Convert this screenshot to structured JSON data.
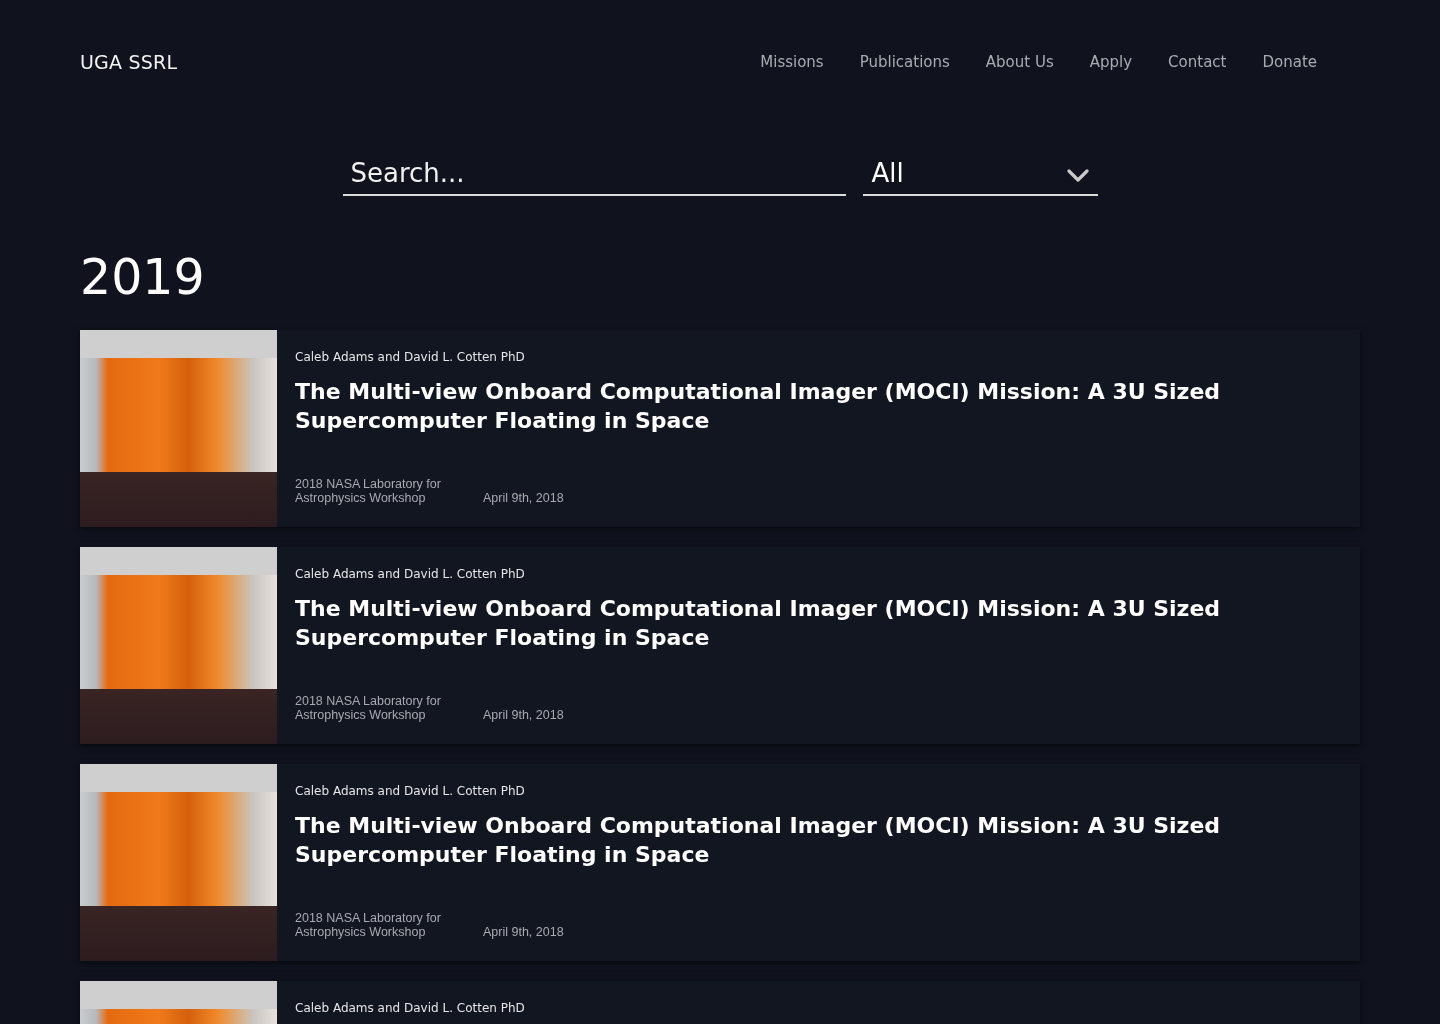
{
  "header": {
    "logo": "UGA SSRL",
    "nav": [
      "Missions",
      "Publications",
      "About Us",
      "Apply",
      "Contact",
      "Donate"
    ]
  },
  "filters": {
    "search": {
      "placeholder": "Search..."
    },
    "category": {
      "value": "All"
    }
  },
  "sections": [
    {
      "year": "2019",
      "publications": [
        {
          "authors": "Caleb Adams and David L. Cotten PhD",
          "title": "The Multi-view Onboard Computational Imager (MOCI) Mission: A 3U Sized Supercomputer Floating in Space",
          "venue": "2018 NASA Laboratory for Astrophysics Workshop",
          "date": "April 9th, 2018"
        },
        {
          "authors": "Caleb Adams and David L. Cotten PhD",
          "title": "The Multi-view Onboard Computational Imager (MOCI) Mission: A 3U Sized Supercomputer Floating in Space",
          "venue": "2018 NASA Laboratory for Astrophysics Workshop",
          "date": "April 9th, 2018"
        },
        {
          "authors": "Caleb Adams and David L. Cotten PhD",
          "title": "The Multi-view Onboard Computational Imager (MOCI) Mission: A 3U Sized Supercomputer Floating in Space",
          "venue": "2018 NASA Laboratory for Astrophysics Workshop",
          "date": "April 9th, 2018"
        },
        {
          "authors": "Caleb Adams and David L. Cotten PhD"
        }
      ]
    }
  ]
}
